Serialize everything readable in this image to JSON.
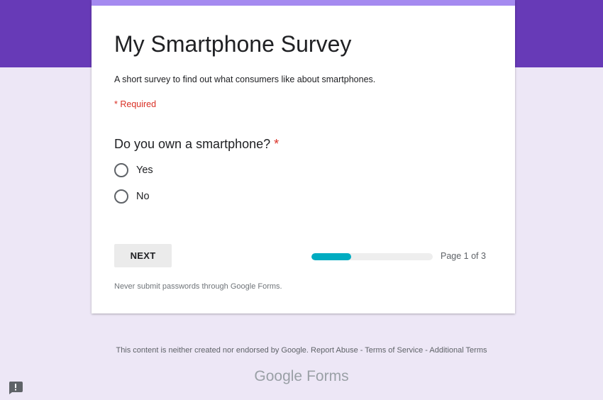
{
  "theme": {
    "header_color": "#673ab7",
    "accent_bar_color": "#a58af0",
    "background_color": "#ede7f6",
    "required_color": "#d93025",
    "progress_color": "#00acc1"
  },
  "form": {
    "title": "My Smartphone Survey",
    "description": "A short survey to find out what consumers like about smartphones.",
    "required_note": "* Required"
  },
  "question": {
    "text": "Do you own a smartphone?",
    "required_marker": "*",
    "options": [
      {
        "label": "Yes",
        "selected": false
      },
      {
        "label": "No",
        "selected": false
      }
    ]
  },
  "navigation": {
    "next_label": "NEXT",
    "progress_fraction": 0.33,
    "page_indicator": "Page 1 of 3"
  },
  "warning": "Never submit passwords through Google Forms.",
  "footer": {
    "disclaimer": "This content is neither created nor endorsed by Google.",
    "report_abuse": "Report Abuse",
    "separator": "-",
    "terms": "Terms of Service",
    "additional_terms": "Additional Terms",
    "logo_google": "Google",
    "logo_forms": "Forms"
  },
  "report_icon": "exclamation-feedback-icon"
}
